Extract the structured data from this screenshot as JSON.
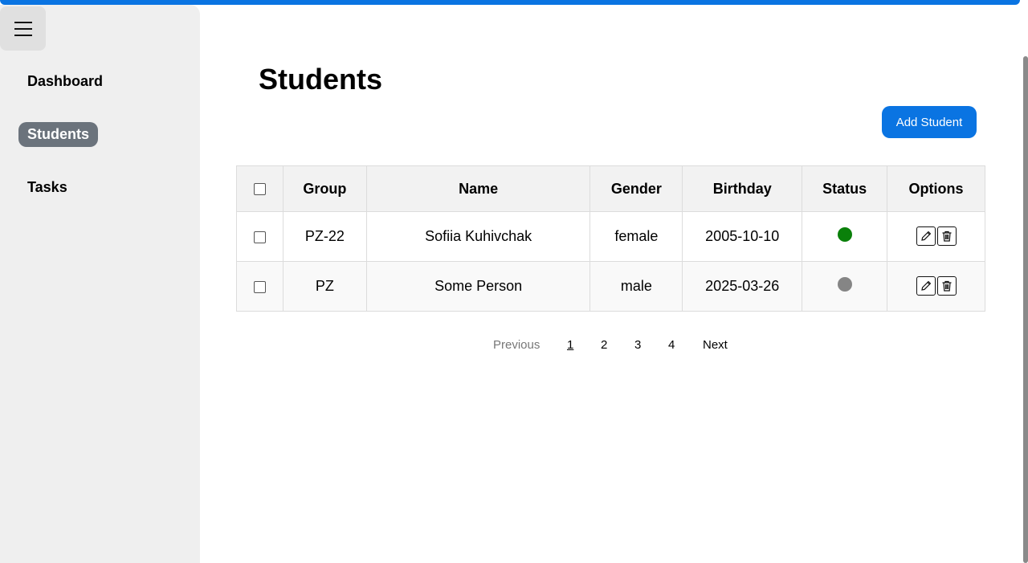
{
  "sidebar": {
    "menu_icon": "hamburger-menu-icon",
    "items": [
      {
        "label": "Dashboard"
      },
      {
        "label": "Students"
      },
      {
        "label": "Tasks"
      }
    ],
    "active": "Students"
  },
  "page": {
    "title": "Students",
    "add_button": "Add Student"
  },
  "table": {
    "headers": [
      "Group",
      "Name",
      "Gender",
      "Birthday",
      "Status",
      "Options"
    ],
    "rows": [
      {
        "group": "PZ-22",
        "name": "Sofiia Kuhivchak",
        "gender": "female",
        "birthday": "2005-10-10",
        "status_color": "#0a800a"
      },
      {
        "group": "PZ",
        "name": "Some Person",
        "gender": "male",
        "birthday": "2025-03-26",
        "status_color": "#858585"
      }
    ],
    "option_icons": [
      "edit-icon",
      "trash-icon"
    ]
  },
  "pagination": {
    "previous": "Previous",
    "pages": [
      "1",
      "2",
      "3",
      "4"
    ],
    "current": "1",
    "next": "Next"
  },
  "colors": {
    "accent": "#0a74e2",
    "sidebar_bg": "#efefef",
    "active_nav": "#6b737c"
  }
}
